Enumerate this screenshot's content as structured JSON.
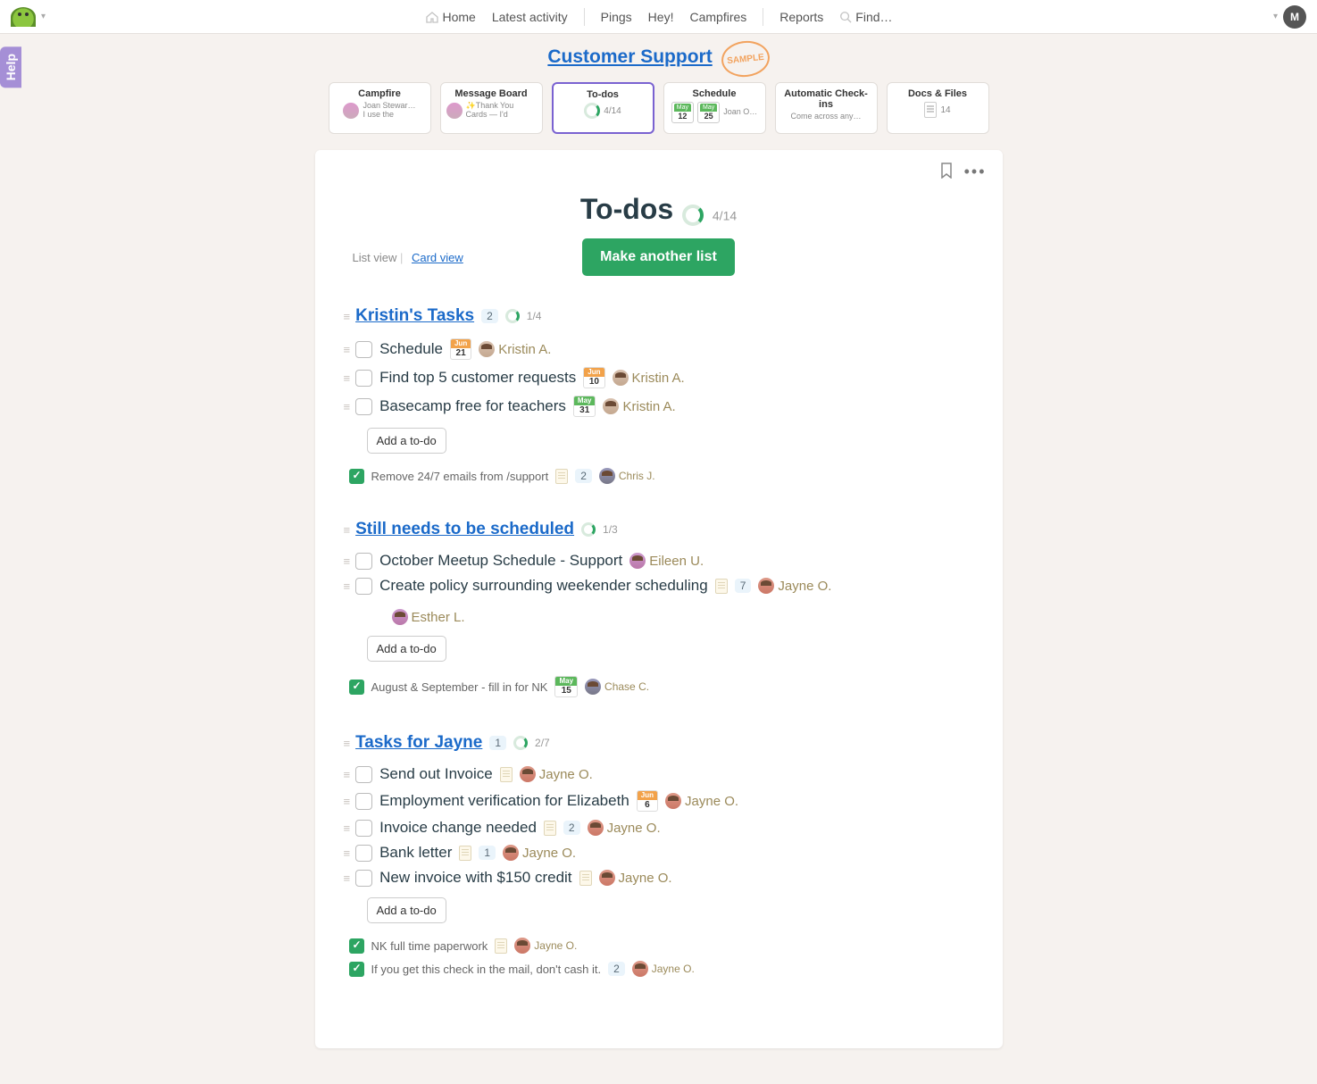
{
  "nav": {
    "home": "Home",
    "latest": "Latest activity",
    "pings": "Pings",
    "hey": "Hey!",
    "campfires": "Campfires",
    "reports": "Reports",
    "find": "Find…",
    "avatar_initial": "M"
  },
  "help_label": "Help",
  "project": {
    "title": "Customer Support",
    "stamp": "SAMPLE"
  },
  "tools": {
    "campfire": {
      "title": "Campfire",
      "name": "Joan Stewar…",
      "snippet": "I use the"
    },
    "message_board": {
      "title": "Message Board",
      "snippet": "✨Thank You Cards — I'd"
    },
    "todos": {
      "title": "To-dos",
      "count": "4/14"
    },
    "schedule": {
      "title": "Schedule",
      "d1m": "May",
      "d1d": "12",
      "d2m": "May",
      "d2d": "25",
      "who": "Joan O…"
    },
    "checkins": {
      "title": "Automatic Check-ins",
      "snippet": "Come across any…"
    },
    "docs": {
      "title": "Docs & Files",
      "count": "14"
    }
  },
  "page": {
    "title": "To-dos",
    "count": "4/14",
    "list_view": "List view",
    "card_view": "Card view",
    "make_btn": "Make another list",
    "add_todo_btn": "Add a to-do"
  },
  "lists": {
    "kristin": {
      "title": "Kristin's Tasks",
      "comments": "2",
      "count": "1/4",
      "items": [
        {
          "text": "Schedule",
          "date_m": "Jun",
          "date_d": "21",
          "assignee": "Kristin A."
        },
        {
          "text": "Find top 5 customer requests",
          "date_m": "Jun",
          "date_d": "10",
          "assignee": "Kristin A."
        },
        {
          "text": "Basecamp free for teachers",
          "date_m": "May",
          "date_d": "31",
          "assignee": "Kristin A."
        }
      ],
      "done": [
        {
          "text": "Remove 24/7 emails from /support",
          "comments": "2",
          "assignee": "Chris J."
        }
      ]
    },
    "still": {
      "title": "Still needs to be scheduled",
      "count": "1/3",
      "items": [
        {
          "text": "October Meetup Schedule - Support",
          "assignee": "Eileen U."
        },
        {
          "text": "Create policy surrounding weekender scheduling",
          "comments": "7",
          "assignee": "Jayne O.",
          "extra_assignee": "Esther L."
        }
      ],
      "done": [
        {
          "text": "August & September - fill in for NK",
          "date_m": "May",
          "date_d": "15",
          "assignee": "Chase C."
        }
      ]
    },
    "jayne": {
      "title": "Tasks for Jayne",
      "comments": "1",
      "count": "2/7",
      "items": [
        {
          "text": "Send out Invoice",
          "note": true,
          "assignee": "Jayne O."
        },
        {
          "text": "Employment verification for Elizabeth",
          "date_m": "Jun",
          "date_d": "6",
          "assignee": "Jayne O."
        },
        {
          "text": "Invoice change needed",
          "note": true,
          "comments": "2",
          "assignee": "Jayne O."
        },
        {
          "text": "Bank letter",
          "note": true,
          "comments": "1",
          "assignee": "Jayne O."
        },
        {
          "text": "New invoice with $150 credit",
          "note": true,
          "assignee": "Jayne O."
        }
      ],
      "done": [
        {
          "text": "NK full time paperwork",
          "note": true,
          "assignee": "Jayne O."
        },
        {
          "text": "If you get this check in the mail, don't cash it.",
          "comments": "2",
          "assignee": "Jayne O."
        }
      ]
    }
  }
}
